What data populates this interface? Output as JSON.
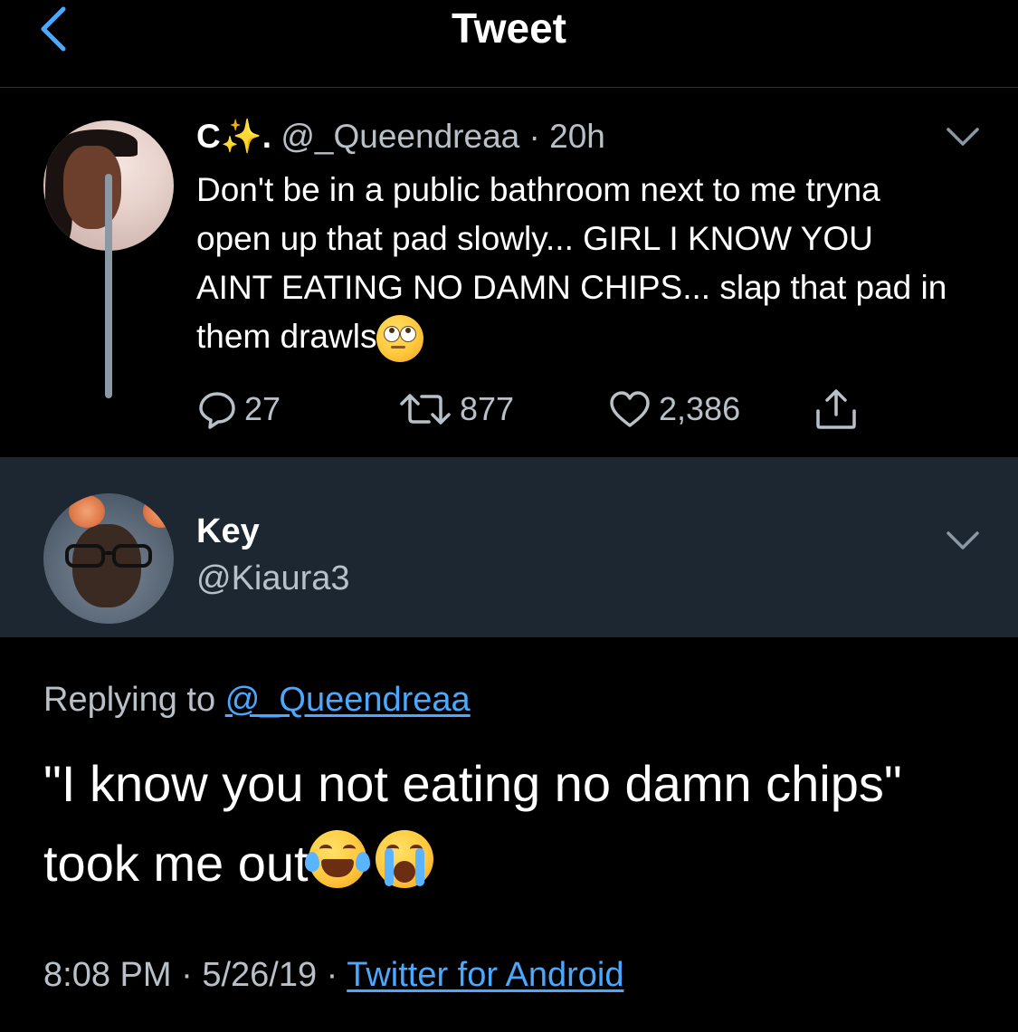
{
  "header": {
    "title": "Tweet",
    "back_icon": "chevron-left-icon"
  },
  "colors": {
    "background": "#000000",
    "band_background": "#1c2732",
    "muted_text": "#b8c0c8",
    "link": "#4aa8ff"
  },
  "parent_tweet": {
    "display_name": "C✨.",
    "handle": "@_Queendreaa",
    "separator": "·",
    "time": "20h",
    "body": "Don't be in a public bathroom next to me tryna open up that pad slowly... GIRL I KNOW YOU AINT EATING NO DAMN CHIPS... slap that pad in them drawls",
    "body_emoji": "face-with-rolling-eyes-emoji",
    "actions": {
      "reply_count": "27",
      "retweet_count": "877",
      "like_count": "2,386"
    }
  },
  "reply_author": {
    "display_name": "Key",
    "handle": "@Kiaura3"
  },
  "reply": {
    "replying_to_label": "Replying to",
    "replying_to_handle": "@_Queendreaa",
    "text_line1": "\"I know you not eating no damn chips\"",
    "text_line2": "took me out",
    "emojis": [
      "face-with-tears-of-joy-emoji",
      "loudly-crying-face-emoji"
    ],
    "time": "8:08 PM",
    "sep1": "·",
    "date": "5/26/19",
    "sep2": "·",
    "source": "Twitter for Android"
  }
}
